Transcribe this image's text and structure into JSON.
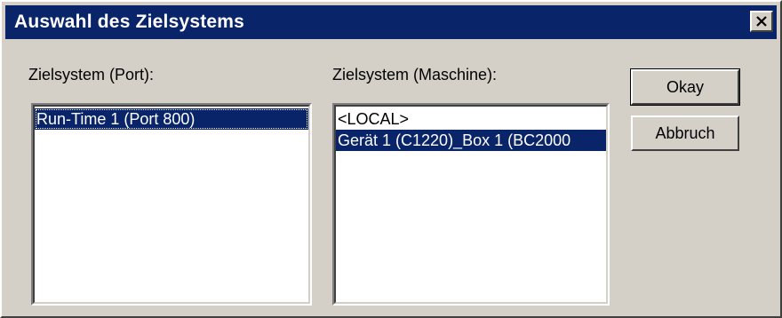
{
  "window": {
    "title": "Auswahl des Zielsystems"
  },
  "port_section": {
    "label": "Zielsystem (Port):",
    "items": [
      "Run-Time 1 (Port 800)"
    ],
    "selected_index": 0
  },
  "machine_section": {
    "label": "Zielsystem (Maschine):",
    "items": [
      "<LOCAL>",
      "Gerät 1 (C1220)_Box 1 (BC2000"
    ],
    "selected_index": 1
  },
  "buttons": {
    "ok_label": "Okay",
    "cancel_label": "Abbruch"
  },
  "icons": {
    "close": "close-icon"
  },
  "colors": {
    "titlebar": "#0a246a",
    "face": "#d4d0c8",
    "selection": "#0a246a"
  }
}
